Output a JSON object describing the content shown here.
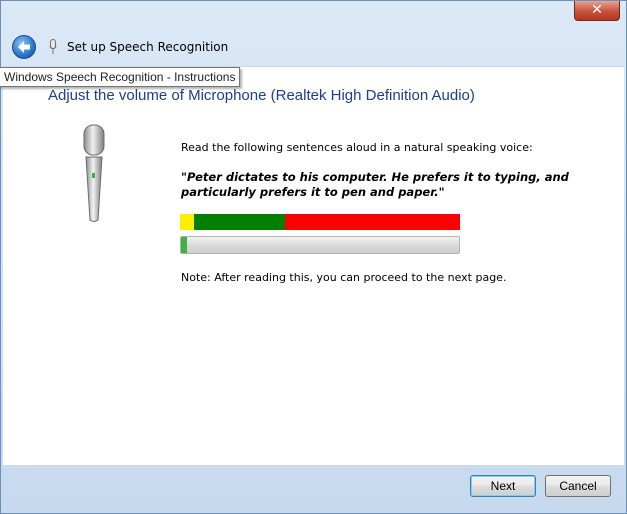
{
  "window": {
    "title": "Set up Speech Recognition",
    "close_label": "✕"
  },
  "tooltip": "Windows Speech Recognition - Instructions",
  "main": {
    "heading": "Adjust the volume of Microphone (Realtek High Definition Audio)",
    "instruction": "Read the following sentences aloud in a natural speaking voice:",
    "sentence": "\"Peter dictates to his computer. He prefers it to typing, and particularly prefers it to pen and paper.\"",
    "note": "Note: After reading this, you can proceed to the next page."
  },
  "level_meter": {
    "segments": [
      {
        "name": "low",
        "color": "#ffee00",
        "fraction": 0.05
      },
      {
        "name": "good",
        "color": "#008000",
        "fraction": 0.325
      },
      {
        "name": "high",
        "color": "#ff0000",
        "fraction": 0.625
      }
    ]
  },
  "progress": {
    "fraction": 0.004,
    "color": "#3fb23f"
  },
  "buttons": {
    "next_label": "Next",
    "cancel_label": "Cancel"
  },
  "icons": {
    "back": "back-arrow-icon",
    "microphone_small": "microphone-icon",
    "microphone_large": "microphone-illustration"
  }
}
